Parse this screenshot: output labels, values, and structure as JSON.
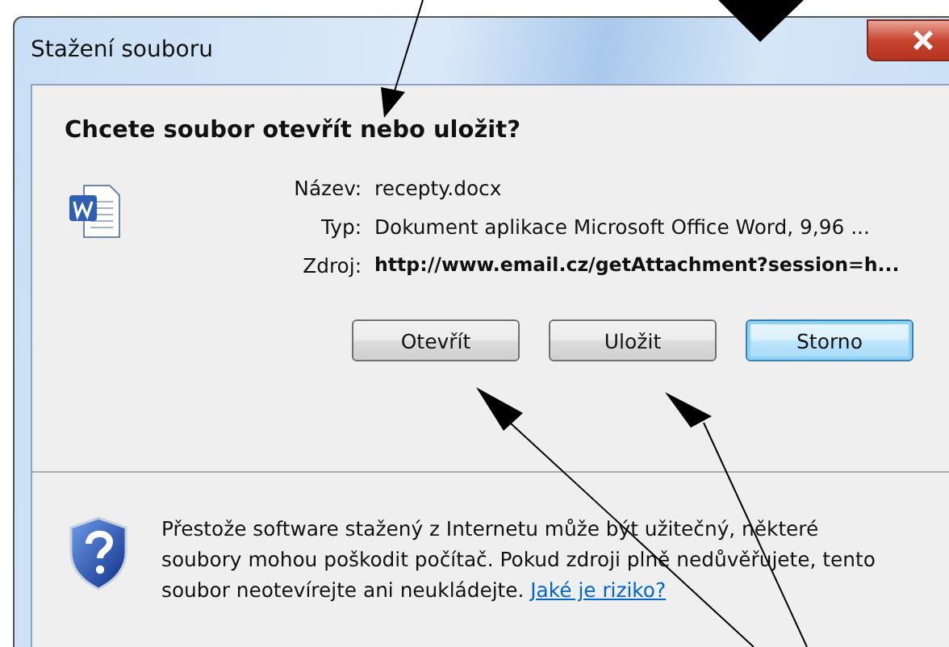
{
  "window": {
    "title": "Stažení souboru"
  },
  "heading": "Chcete soubor otevřít nebo uložit?",
  "fields": [
    {
      "label": "Název:",
      "value": "recepty.docx",
      "emphasized": false
    },
    {
      "label": "Typ:",
      "value": "Dokument aplikace Microsoft Office Word, 9,96 ...",
      "emphasized": false
    },
    {
      "label": "Zdroj:",
      "value": "http://www.email.cz/getAttachment?session=h...",
      "emphasized": true
    }
  ],
  "buttons": [
    {
      "label": "Otevřít",
      "default": false
    },
    {
      "label": "Uložit",
      "default": false
    },
    {
      "label": "Storno",
      "default": true
    }
  ],
  "warning": {
    "text": "Přestože software stažený z Internetu může být užitečný, některé soubory mohou poškodit počítač. Pokud zdroji plně nedůvěřujete, tento soubor neotevírejte ani neukládejte.",
    "link": "Jaké je riziko?"
  }
}
